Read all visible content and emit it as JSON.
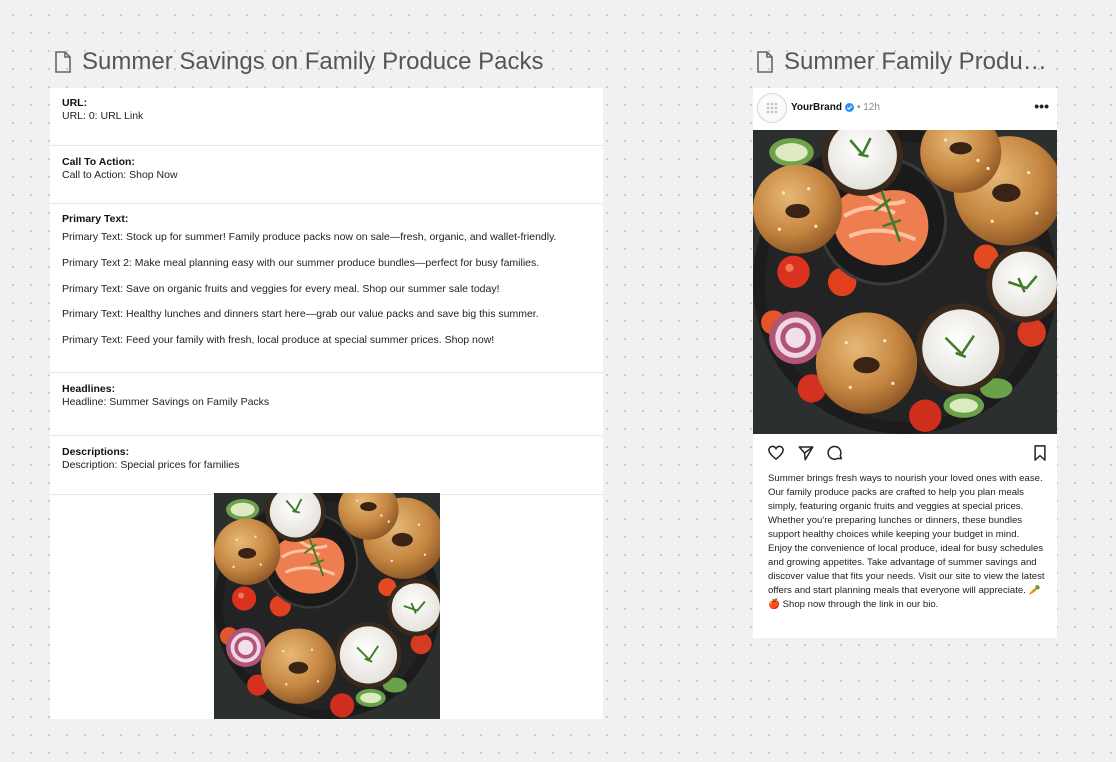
{
  "frames": {
    "left_title": "Summer Savings on Family Produce Packs",
    "right_title": "Summer Family Produ…"
  },
  "document": {
    "url": {
      "label": "URL:",
      "value": "URL: 0: URL Link"
    },
    "call_to_action": {
      "label": "Call To Action:",
      "value": "Call to Action: Shop Now"
    },
    "primary_text": {
      "label": "Primary Text:",
      "lines": [
        "Primary Text: Stock up for summer! Family produce packs now on sale—fresh, organic, and wallet-friendly.",
        "Primary Text 2: Make meal planning easy with our summer produce bundles—perfect for busy families.",
        "Primary Text: Save on organic fruits and veggies for every meal. Shop our summer sale today!",
        "Primary Text: Healthy lunches and dinners start here—grab our value packs and save big this summer.",
        "Primary Text: Feed your family with fresh, local produce at special summer prices. Shop now!"
      ]
    },
    "headlines": {
      "label": "Headlines:",
      "value": "Headline: Summer Savings on Family Packs"
    },
    "descriptions": {
      "label": "Descriptions:",
      "value": "Description: Special prices for families"
    }
  },
  "post": {
    "brand": "YourBrand",
    "time": "• 12h",
    "caption": "Summer brings fresh ways to nourish your loved ones with ease. Our family produce packs are crafted to help you plan meals simply, featuring organic fruits and veggies at special prices. Whether you're preparing lunches or dinners, these bundles support healthy choices while keeping your budget in mind. Enjoy the convenience of local produce, ideal for busy schedules and growing appetites. Take advantage of summer savings and discover value that fits your needs. Visit our site to view the latest offers and start planning meals that everyone will appreciate. 🥕🍎 Shop now through the link in our bio."
  },
  "icons": {
    "frame": "document-icon",
    "more": "more-dots-icon",
    "like": "heart-icon",
    "share": "send-icon",
    "comment": "comment-icon",
    "save": "bookmark-icon"
  },
  "colors": {
    "canvas": "#f1f1f3",
    "card": "#ffffff",
    "verified": "#2f8df5",
    "plate": "#1c1c1c"
  }
}
